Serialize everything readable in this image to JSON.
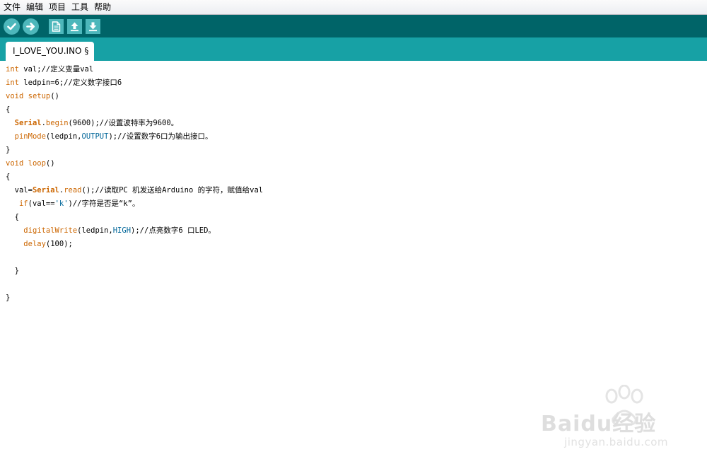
{
  "menu": {
    "file": "文件",
    "edit": "编辑",
    "project": "项目",
    "tools": "工具",
    "help": "帮助"
  },
  "toolbar": {
    "icons": [
      "verify-icon",
      "upload-icon",
      "new-icon",
      "open-icon",
      "save-icon"
    ]
  },
  "tab": {
    "name": "I_LOVE_YOU.INO §"
  },
  "code": {
    "l1": {
      "t1": "int",
      "t2": " val;//定义变量val"
    },
    "l2": {
      "t1": "int",
      "t2": " ledpin=6;//定义数字接口6"
    },
    "l3": {
      "t1": "void",
      "t2": " ",
      "t3": "setup",
      "t4": "()"
    },
    "l4": {
      "t1": "{"
    },
    "l5": {
      "t0": "  ",
      "t1": "Serial",
      "t2": ".",
      "t3": "begin",
      "t4": "(9600);//设置波特率为9600。"
    },
    "l6": {
      "t0": "  ",
      "t1": "pinMode",
      "t2": "(ledpin,",
      "t3": "OUTPUT",
      "t4": ");//设置数字6口为输出接口。"
    },
    "l7": {
      "t1": "}"
    },
    "l8": {
      "t1": "void",
      "t2": " ",
      "t3": "loop",
      "t4": "()"
    },
    "l9": {
      "t1": "{"
    },
    "l10": {
      "t0": "  val=",
      "t1": "Serial",
      "t2": ".",
      "t3": "read",
      "t4": "();//读取PC 机发送给Arduino 的字符，赋值给val"
    },
    "l11": {
      "t0": "   ",
      "t1": "if",
      "t2": "(val==",
      "t3": "'k'",
      "t4": ")//字符是否是“k”。"
    },
    "l12": {
      "t1": "  {"
    },
    "l13": {
      "t0": "    ",
      "t1": "digitalWrite",
      "t2": "(ledpin,",
      "t3": "HIGH",
      "t4": ");//点亮数字6 口LED。"
    },
    "l14": {
      "t0": "    ",
      "t1": "delay",
      "t2": "(100);"
    },
    "l15": {
      "t1": ""
    },
    "l16": {
      "t1": "  }"
    },
    "l17": {
      "t1": ""
    },
    "l18": {
      "t1": "}"
    }
  },
  "watermark": {
    "brand": "Baidu经验",
    "url": "jingyan.baidu.com"
  },
  "colors": {
    "toolbar": "#006468",
    "tabstrip": "#17a1a5",
    "button": "#4db7bb",
    "keyword": "#cc6600",
    "constant": "#006699"
  }
}
